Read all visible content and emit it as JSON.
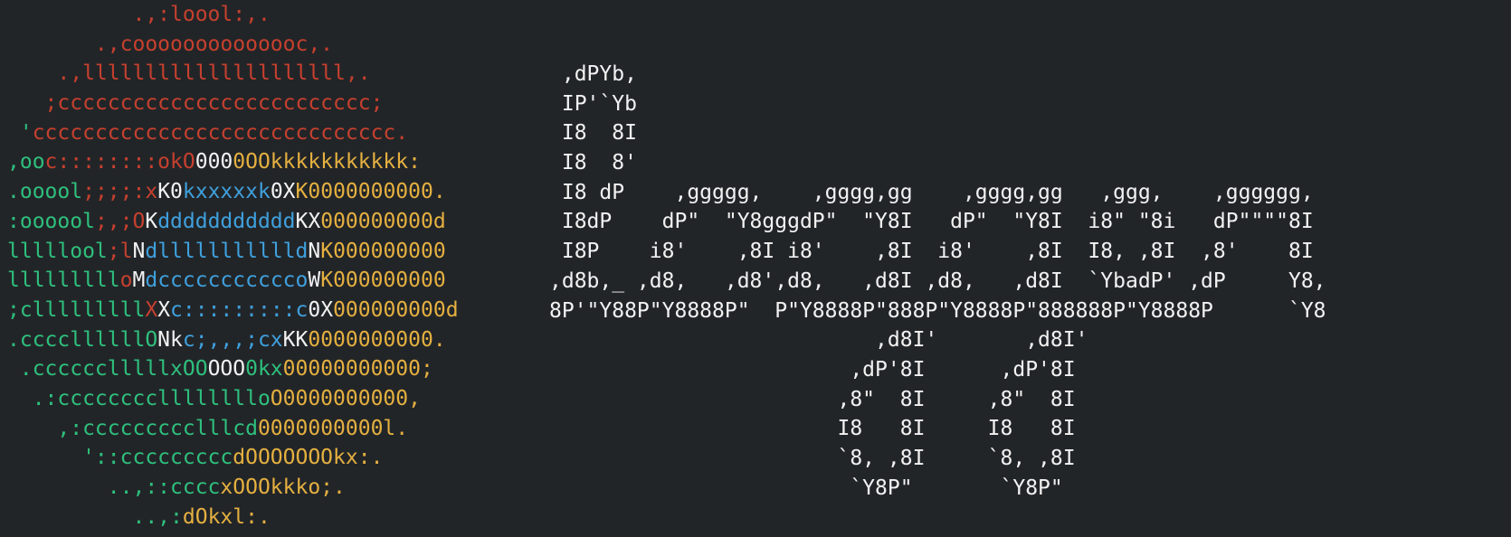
{
  "colors": {
    "background": "#222528",
    "red": "#c6402e",
    "green": "#2ec07d",
    "yellow": "#e5b040",
    "blue": "#3fa0dd",
    "white": "#f2f2f2"
  },
  "logo_lines": [
    [
      {
        "t": "          .,:loool:,.",
        "c": "red"
      }
    ],
    [
      {
        "t": "       .,coooooooooooooc,.",
        "c": "red"
      }
    ],
    [
      {
        "t": "    .,lllllllllllllllllllll,.",
        "c": "red"
      }
    ],
    [
      {
        "t": "   ;ccccccccccccccccccccccccc;",
        "c": "red"
      }
    ],
    [
      {
        "t": " '",
        "c": "green"
      },
      {
        "t": "ccccccccccccccccccccccccccccc.",
        "c": "red"
      }
    ],
    [
      {
        "t": ",oo",
        "c": "green"
      },
      {
        "t": "c::::::::okO",
        "c": "red"
      },
      {
        "t": "000",
        "c": "white"
      },
      {
        "t": "0OOkkkkkkkkkkk:",
        "c": "yellow"
      }
    ],
    [
      {
        "t": ".ooool",
        "c": "green"
      },
      {
        "t": ";;;;:x",
        "c": "red"
      },
      {
        "t": "K0",
        "c": "white"
      },
      {
        "t": "kxxxxxk",
        "c": "blue"
      },
      {
        "t": "0X",
        "c": "white"
      },
      {
        "t": "K0000000000.",
        "c": "yellow"
      }
    ],
    [
      {
        "t": ":oooool",
        "c": "green"
      },
      {
        "t": ";,;O",
        "c": "red"
      },
      {
        "t": "K",
        "c": "white"
      },
      {
        "t": "ddddddddddd",
        "c": "blue"
      },
      {
        "t": "KX",
        "c": "white"
      },
      {
        "t": "000000000d",
        "c": "yellow"
      }
    ],
    [
      {
        "t": "lllllool",
        "c": "green"
      },
      {
        "t": ";l",
        "c": "red"
      },
      {
        "t": "N",
        "c": "white"
      },
      {
        "t": "dllllllllllld",
        "c": "blue"
      },
      {
        "t": "N",
        "c": "white"
      },
      {
        "t": "K000000000",
        "c": "yellow"
      }
    ],
    [
      {
        "t": "lllllllll",
        "c": "green"
      },
      {
        "t": "o",
        "c": "red"
      },
      {
        "t": "M",
        "c": "white"
      },
      {
        "t": "dccccccccccco",
        "c": "blue"
      },
      {
        "t": "W",
        "c": "white"
      },
      {
        "t": "K000000000",
        "c": "yellow"
      }
    ],
    [
      {
        "t": ";clllllllll",
        "c": "green"
      },
      {
        "t": "X",
        "c": "red"
      },
      {
        "t": "X",
        "c": "white"
      },
      {
        "t": "c:::::::::c",
        "c": "blue"
      },
      {
        "t": "0X",
        "c": "white"
      },
      {
        "t": "000000000d",
        "c": "yellow"
      }
    ],
    [
      {
        "t": ".ccccllllllO",
        "c": "green"
      },
      {
        "t": "Nk",
        "c": "white"
      },
      {
        "t": "c;,,,;cx",
        "c": "blue"
      },
      {
        "t": "KK",
        "c": "white"
      },
      {
        "t": "0000000000.",
        "c": "yellow"
      }
    ],
    [
      {
        "t": " .cccccclllllxOO",
        "c": "green"
      },
      {
        "t": "OOO",
        "c": "white"
      },
      {
        "t": "0kx",
        "c": "green"
      },
      {
        "t": "00000000000;",
        "c": "yellow"
      }
    ],
    [
      {
        "t": "  .:ccccccccllllllllo",
        "c": "green"
      },
      {
        "t": "O0000000000,",
        "c": "yellow"
      }
    ],
    [
      {
        "t": "    ,:ccccccccclllcd",
        "c": "green"
      },
      {
        "t": "0000000000l.",
        "c": "yellow"
      }
    ],
    [
      {
        "t": "      '::ccccccccc",
        "c": "green"
      },
      {
        "t": "dOOOOOOOkx:.",
        "c": "yellow"
      }
    ],
    [
      {
        "t": "        ..,::cccc",
        "c": "green"
      },
      {
        "t": "xOOOkkko;.",
        "c": "yellow"
      }
    ],
    [
      {
        "t": "          ..,:",
        "c": "green"
      },
      {
        "t": "dOkxl:.",
        "c": "yellow"
      }
    ]
  ],
  "banner_lines": [
    " ,dPYb,",
    " IP'`Yb",
    " I8  8I",
    " I8  8'",
    " I8 dP    ,ggggg,    ,gggg,gg    ,gggg,gg   ,ggg,    ,gggggg,",
    " I8dP    dP\"  \"Y8gggdP\"  \"Y8I   dP\"  \"Y8I  i8\" \"8i   dP\"\"\"\"8I",
    " I8P    i8'    ,8I i8'    ,8I  i8'    ,8I  I8, ,8I  ,8'    8I",
    ",d8b,_ ,d8,   ,d8',d8,   ,d8I ,d8,   ,d8I  `YbadP' ,dP     Y8,",
    "8P'\"Y88P\"Y8888P\"  P\"Y8888P\"888P\"Y8888P\"888888P\"Y8888P      `Y8",
    "                          ,d8I'       ,d8I'",
    "                        ,dP'8I      ,dP'8I",
    "                       ,8\"  8I     ,8\"  8I",
    "                       I8   8I     I8   8I",
    "                       `8, ,8I     `8, ,8I",
    "                        `Y8P\"       `Y8P\""
  ]
}
